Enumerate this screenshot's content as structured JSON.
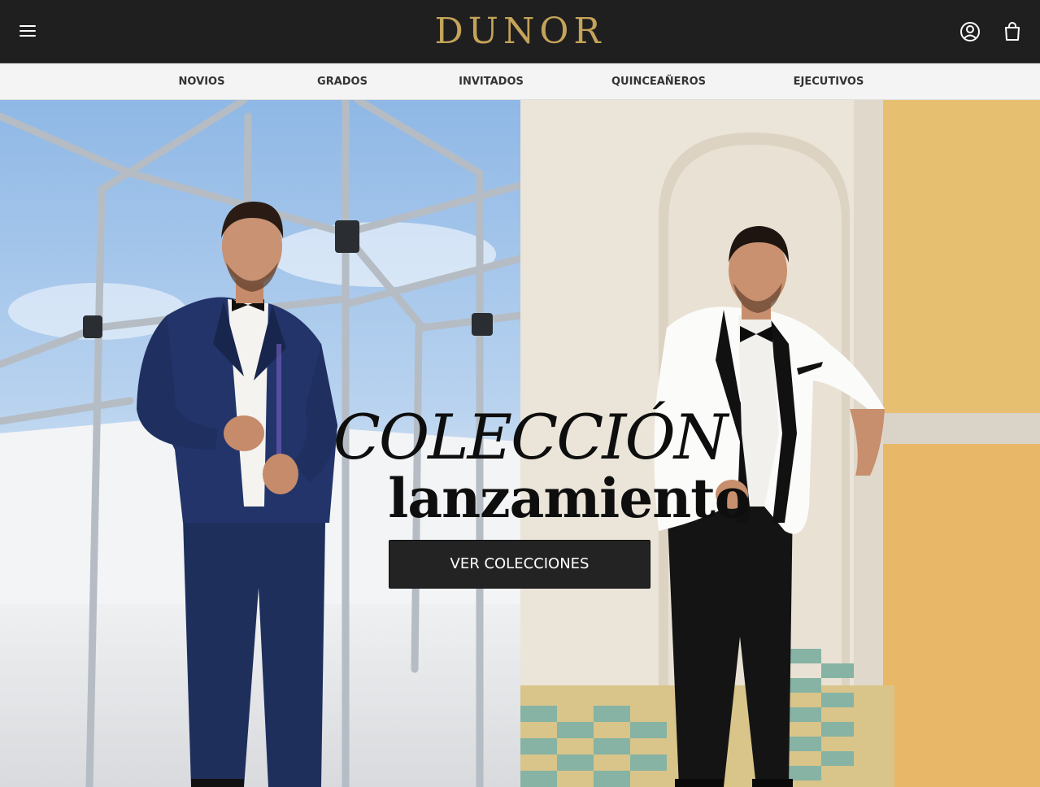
{
  "header": {
    "brand": "DUNOR",
    "menu_icon": "hamburger-menu-icon",
    "account_icon": "user-account-icon",
    "cart_icon": "shopping-bag-icon",
    "background": "#1f1f1f",
    "brand_color": "#c4a35a"
  },
  "nav": {
    "items": [
      {
        "label": "NOVIOS"
      },
      {
        "label": "GRADOS"
      },
      {
        "label": "INVITADOS"
      },
      {
        "label": "QUINCEAÑEROS"
      },
      {
        "label": "EJECUTIVOS"
      }
    ]
  },
  "hero": {
    "title_line1": "COLECCIÓN",
    "title_line2": "lanzamiento",
    "cta_label": "VER COLECCIONES",
    "cta_color": "#232323"
  }
}
